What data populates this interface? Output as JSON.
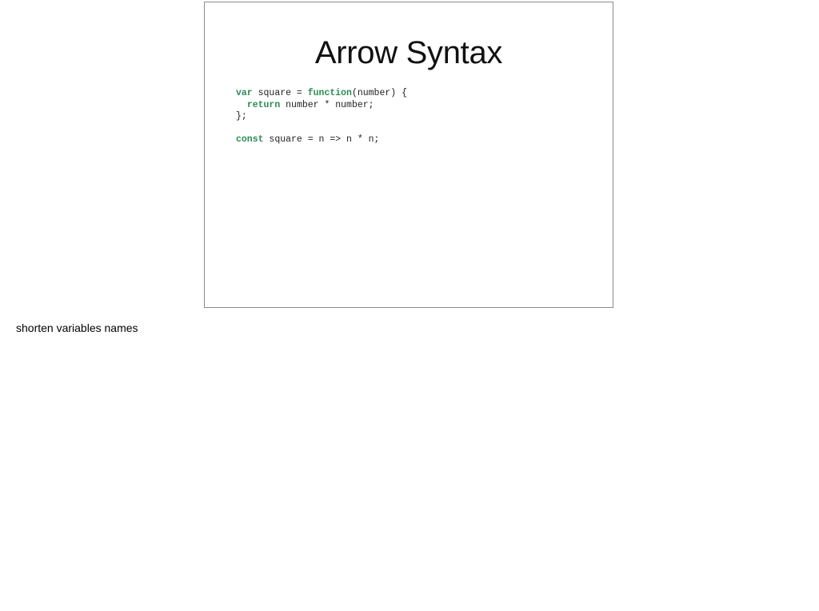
{
  "slide": {
    "title": "Arrow Syntax",
    "code_lines": [
      [
        {
          "text": "var",
          "kind": "keyword"
        },
        {
          "text": " square = ",
          "kind": "plain"
        },
        {
          "text": "function",
          "kind": "keyword"
        },
        {
          "text": "(number) {",
          "kind": "plain"
        }
      ],
      [
        {
          "text": "  ",
          "kind": "plain"
        },
        {
          "text": "return",
          "kind": "keyword"
        },
        {
          "text": " number * number;",
          "kind": "plain"
        }
      ],
      [
        {
          "text": "};",
          "kind": "plain"
        }
      ],
      [],
      [
        {
          "text": "const",
          "kind": "keyword"
        },
        {
          "text": " square = n => n * n;",
          "kind": "plain"
        }
      ]
    ],
    "colors": {
      "keyword": "#2e8b57",
      "plain": "#222222",
      "border": "#8a8a8a"
    }
  },
  "notes": {
    "text": "shorten variables names"
  }
}
